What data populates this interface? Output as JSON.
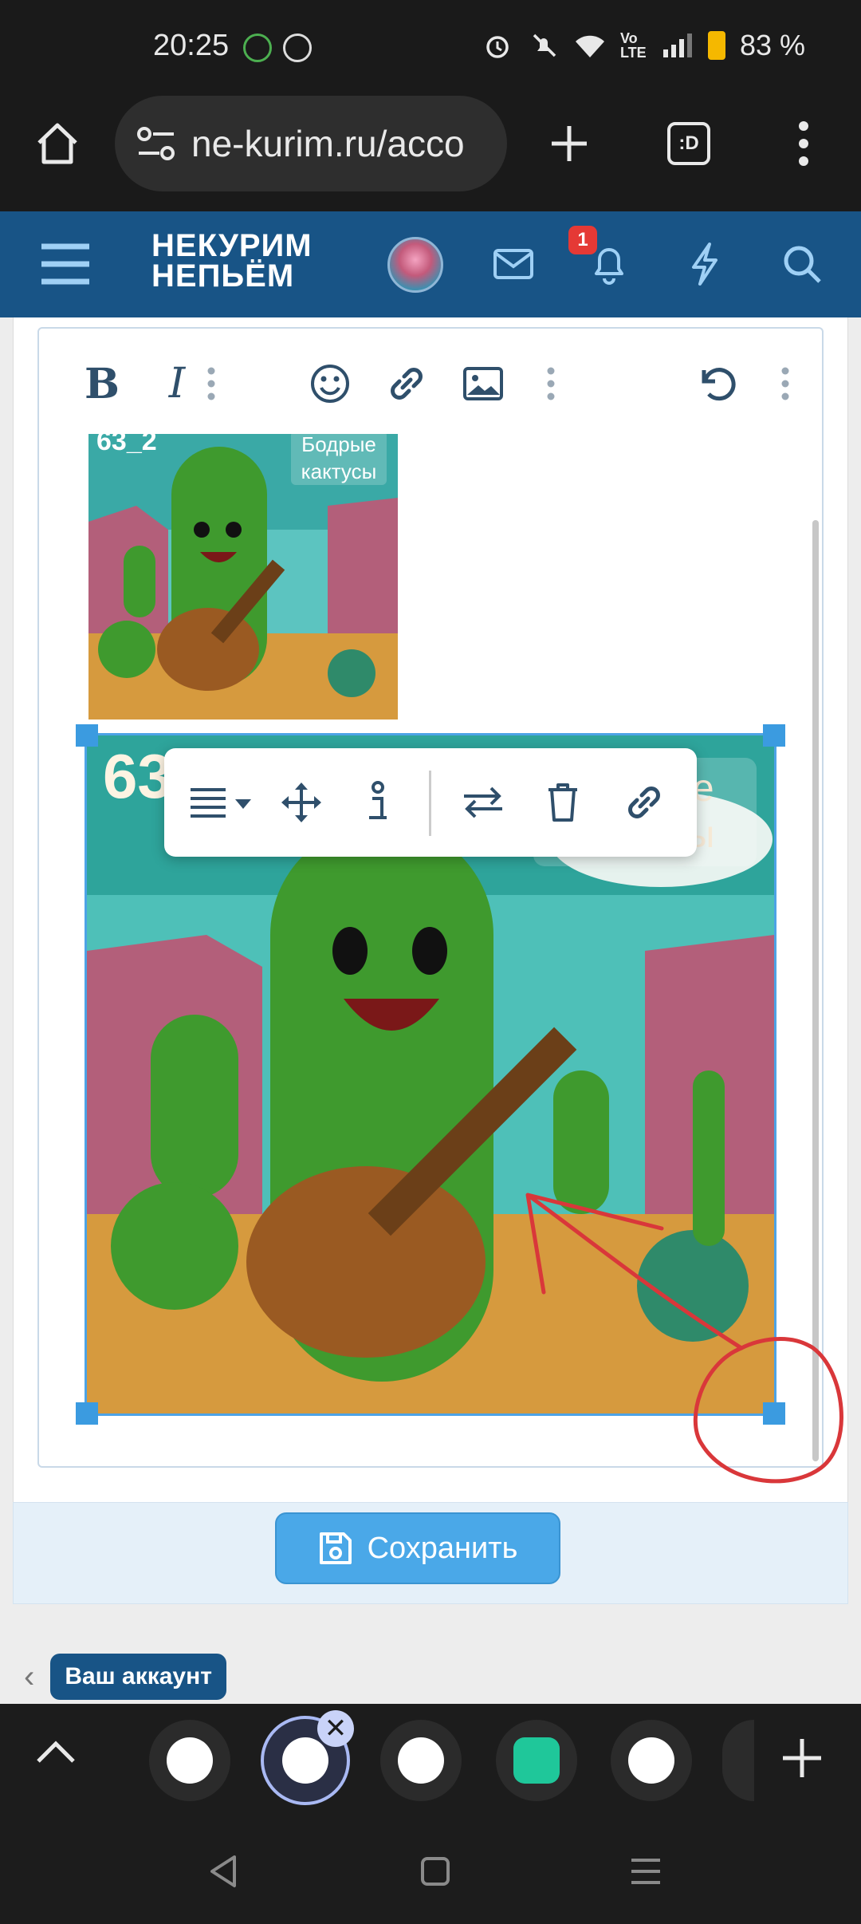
{
  "status_bar": {
    "time": "20:25",
    "network": "Vo LTE",
    "battery": "83 %"
  },
  "browser": {
    "url": "ne-kurim.ru/acco",
    "tabs_count_label": ":D"
  },
  "site": {
    "logo_line1": "НЕКУРИМ",
    "logo_line2": "НЕПЬЁМ",
    "notification_count": "1"
  },
  "editor": {
    "small_image": {
      "tag": "63_2",
      "caption": "Бодрые кактусы"
    },
    "large_image": {
      "tag": "63_2",
      "caption": "Бодрые кактусы"
    }
  },
  "save_button": "Сохранить",
  "breadcrumb": {
    "label": "Ваш аккаунт"
  },
  "colors": {
    "header": "#185486",
    "accent": "#4aa8e8",
    "handle": "#3b9be0",
    "annotation": "#d9373a"
  }
}
